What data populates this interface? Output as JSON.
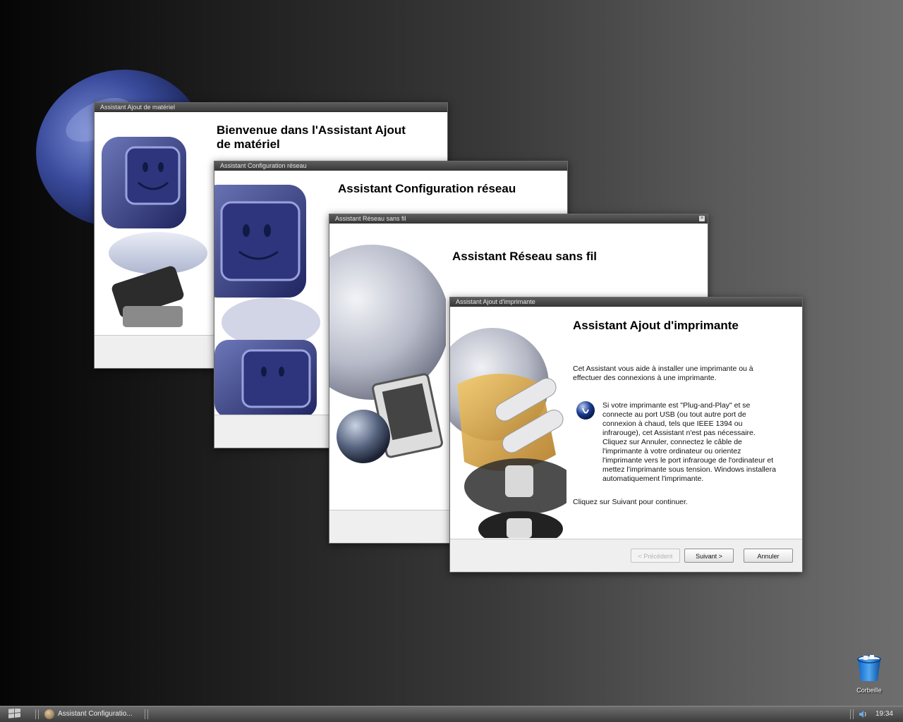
{
  "desktop": {
    "recycle_bin_label": "Corbeille"
  },
  "windows": {
    "hardware": {
      "titlebar": "Assistant Ajout de matériel",
      "heading": "Bienvenue dans l'Assistant Ajout de matériel"
    },
    "network": {
      "titlebar": "Assistant Configuration réseau",
      "heading": "Assistant Configuration réseau"
    },
    "wireless": {
      "titlebar": "Assistant Réseau sans fil",
      "heading": "Assistant Réseau sans fil"
    },
    "printer": {
      "titlebar": "Assistant Ajout d'imprimante",
      "heading": "Assistant Ajout d'imprimante",
      "intro": "Cet Assistant vous aide à installer une imprimante ou à effectuer des connexions à une imprimante.",
      "pnp_text": "Si votre imprimante est \"Plug-and-Play\" et se connecte au port USB (ou tout autre port de connexion à chaud, tels que IEEE 1394 ou infrarouge), cet Assistant n'est pas nécessaire. Cliquez sur Annuler, connectez le câble de l'imprimante à votre ordinateur ou orientez l'imprimante vers le port infrarouge de l'ordinateur et mettez l'imprimante sous tension. Windows installera automatiquement l'imprimante.",
      "continue_text": "Cliquez sur Suivant pour continuer.",
      "buttons": {
        "back": "< Précédent",
        "next": "Suivant >",
        "cancel": "Annuler"
      }
    }
  },
  "taskbar": {
    "task_label": "Assistant Configuratio...",
    "clock": "19:34"
  }
}
